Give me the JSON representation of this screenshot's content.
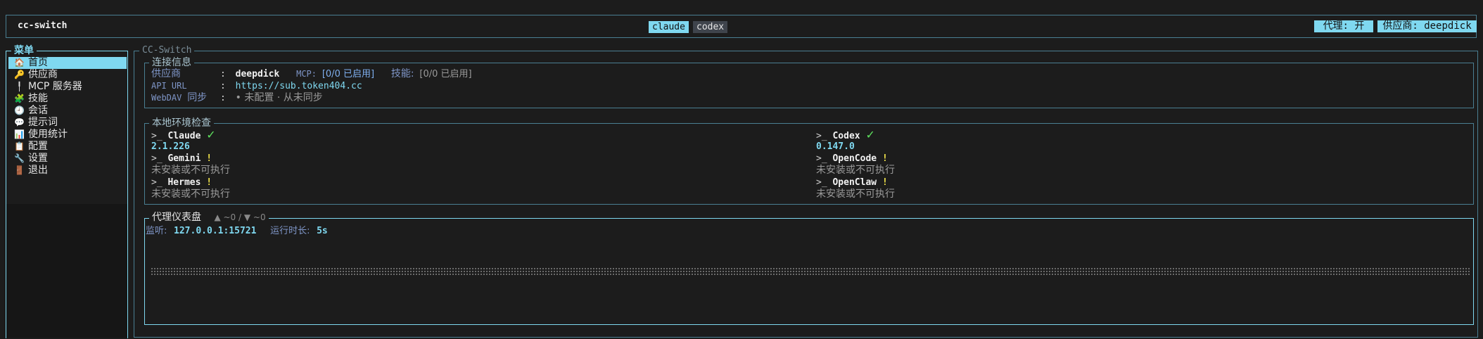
{
  "header": {
    "app_title": "cc-switch",
    "tabs": [
      {
        "label": "claude",
        "active": true
      },
      {
        "label": "codex",
        "active": false
      }
    ],
    "proxy_badge": "代理: 开",
    "provider_badge": "供应商: deepdick"
  },
  "sidebar": {
    "title": "菜单",
    "items": [
      {
        "label": "首页",
        "icon": "house-icon",
        "glyph": "🏠",
        "active": true
      },
      {
        "label": "供应商",
        "icon": "key-icon",
        "glyph": "🔑",
        "active": false
      },
      {
        "label": "MCP 服务器",
        "icon": "plug-icon",
        "glyph": "╿",
        "active": false
      },
      {
        "label": "技能",
        "icon": "puzzle-icon",
        "glyph": "🧩",
        "active": false
      },
      {
        "label": "会话",
        "icon": "clock-icon",
        "glyph": "🕘",
        "active": false
      },
      {
        "label": "提示词",
        "icon": "speech-bubble-icon",
        "glyph": "💬",
        "active": false
      },
      {
        "label": "使用统计",
        "icon": "bar-chart-icon",
        "glyph": "📊",
        "active": false
      },
      {
        "label": "配置",
        "icon": "memo-icon",
        "glyph": "📋",
        "active": false
      },
      {
        "label": "设置",
        "icon": "wrench-icon",
        "glyph": "🔧",
        "active": false
      },
      {
        "label": "退出",
        "icon": "door-icon",
        "glyph": "🚪",
        "active": false
      }
    ]
  },
  "main": {
    "title": "CC-Switch",
    "connection": {
      "title": "连接信息",
      "provider_label": "供应商",
      "provider_value": "deepdick",
      "mcp_label": "MCP:",
      "mcp_value": "[0/0 已启用]",
      "skills_label": "技能:",
      "skills_value": "[0/0 已启用]",
      "api_url_label": "API URL",
      "api_url_value": "https://sub.token404.cc",
      "webdav_label_a": "WebDAV",
      "webdav_label_b": "同步",
      "webdav_value": "• 未配置 · 从未同步",
      "colon": ":"
    },
    "env_check": {
      "title": "本地环境检查",
      "prompt": ">_",
      "tools": [
        {
          "name": "Claude",
          "status": "ok",
          "mark": "✓",
          "detail": "2.1.226"
        },
        {
          "name": "Codex",
          "status": "ok",
          "mark": "✓",
          "detail": "0.147.0"
        },
        {
          "name": "Gemini",
          "status": "warn",
          "mark": "!",
          "detail": "未安装或不可执行"
        },
        {
          "name": "OpenCode",
          "status": "warn",
          "mark": "!",
          "detail": "未安装或不可执行"
        },
        {
          "name": "Hermes",
          "status": "warn",
          "mark": "!",
          "detail": "未安装或不可执行"
        },
        {
          "name": "OpenClaw",
          "status": "warn",
          "mark": "!",
          "detail": "未安装或不可执行"
        }
      ]
    },
    "proxy": {
      "title": "代理仪表盘",
      "stats": "▲ ~0 / ▼ ~0",
      "listen_label": "监听:",
      "listen_value": "127.0.0.1:15721",
      "uptime_label": "运行时长:",
      "uptime_value": "5s"
    }
  },
  "colors": {
    "accent": "#7fd8f0",
    "border": "#4a7f92",
    "background": "#1c1c1c",
    "ok": "#5ee05e",
    "warn": "#f0e24a"
  }
}
